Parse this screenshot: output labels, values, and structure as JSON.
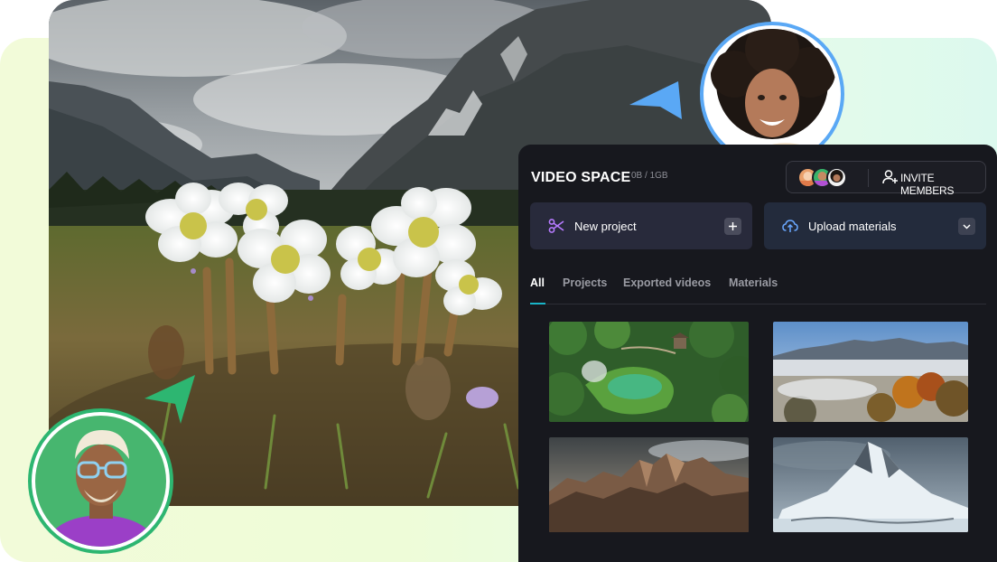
{
  "panel": {
    "title": "VIDEO SPACE",
    "storage": "0B / 1GB",
    "invite_label": "INVITE MEMBERS",
    "new_project_label": "New project",
    "upload_label": "Upload materials",
    "tabs": [
      {
        "label": "All",
        "active": true
      },
      {
        "label": "Projects",
        "active": false
      },
      {
        "label": "Exported videos",
        "active": false
      },
      {
        "label": "Materials",
        "active": false
      }
    ]
  },
  "thumbnails": [
    {
      "name": "forest-spring"
    },
    {
      "name": "foggy-town-mountains"
    },
    {
      "name": "rocky-mountain-ridge"
    },
    {
      "name": "snowy-peak"
    }
  ],
  "colors": {
    "accent_tab": "#19b4c8",
    "cursor_blue": "#5aa8f5",
    "cursor_green": "#2db671",
    "panel_bg": "#17181e"
  },
  "icons": [
    "scissors-icon",
    "plus-icon",
    "cloud-upload-icon",
    "chevron-down-icon",
    "add-user-icon"
  ]
}
